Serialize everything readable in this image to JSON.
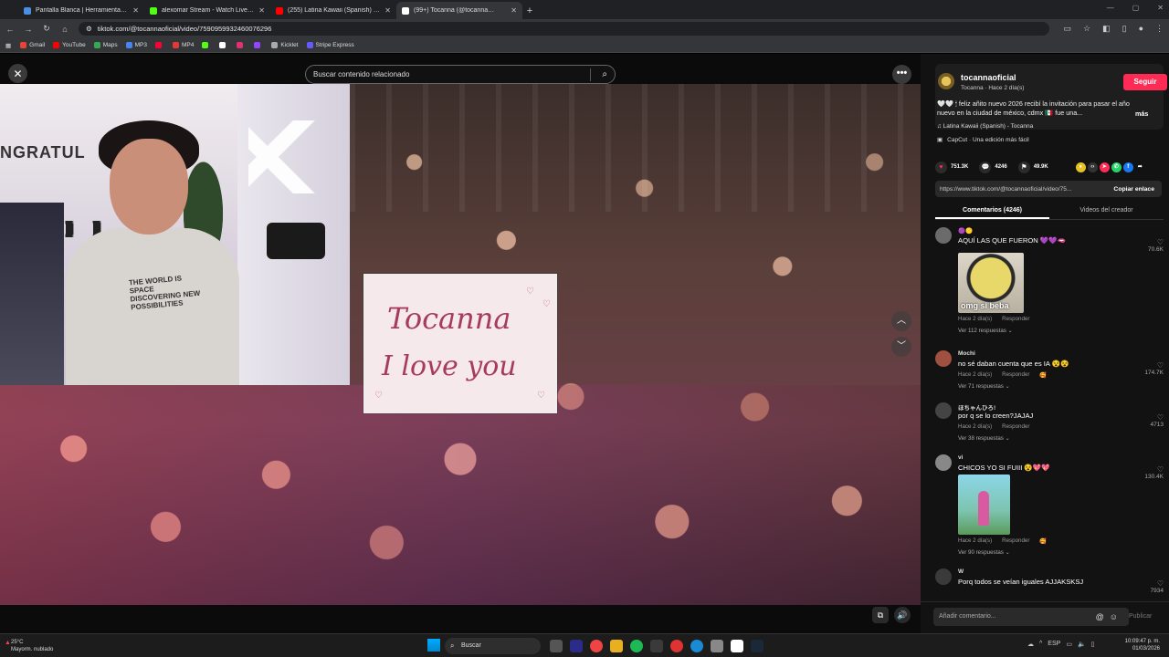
{
  "browser": {
    "tabs": [
      {
        "title": "Pantalla Blanca | Herramienta …",
        "favicon_color": "#4a90e2",
        "active": false
      },
      {
        "title": "alexomar Stream - Watch Live …",
        "favicon_color": "#53fc18",
        "active": false
      },
      {
        "title": "(255) Latina Kawaii (Spanish) - …",
        "favicon_color": "#ff0000",
        "active": false
      },
      {
        "title": "(99+) Tocanna (@tocanna…",
        "favicon_color": "#ffffff",
        "active": true
      }
    ],
    "url": "tiktok.com/@tocannaoficial/video/7590959932460076296",
    "bookmarks": [
      {
        "label": "Gmail",
        "color": "#ea4335"
      },
      {
        "label": "YouTube",
        "color": "#ff0000"
      },
      {
        "label": "Maps",
        "color": "#34a853"
      },
      {
        "label": "MP3",
        "color": "#4285f4"
      },
      {
        "label": "",
        "color": "#ff0033"
      },
      {
        "label": "MP4",
        "color": "#e53935"
      },
      {
        "label": "",
        "color": "#53fc18"
      },
      {
        "label": "",
        "color": "#ffffff"
      },
      {
        "label": "",
        "color": "#e1306c"
      },
      {
        "label": "",
        "color": "#9146ff"
      },
      {
        "label": "Kicklet",
        "color": "#aaaaaa"
      },
      {
        "label": "Stripe Express",
        "color": "#635bff"
      }
    ]
  },
  "viewer": {
    "search_placeholder": "Buscar contenido relacionado",
    "sign_line1": "Tocanna",
    "sign_line2": "I love you",
    "webcam_sign": "NGRATUL",
    "shirt_text": "THE WORLD IS SPACE DISCOVERING NEW POSSIBILITIES"
  },
  "panel": {
    "author_name": "tocannaoficial",
    "author_sub": "Tocanna · Hace 2 día(s)",
    "follow_label": "Seguir",
    "description": "🤍🤍 🕯 feliz añito nuevo 2026 recibí la invitación para pasar el año nuevo en la ciudad de méxico, cdmx 🇲🇽 fue una...",
    "more_label": "más",
    "music": "♫ Latina Kawaii (Spanish) - Tocanna",
    "capcut": "CapCut · Una edición más fácil",
    "likes": "751.3K",
    "comments_count": "4246",
    "saves": "49.9K",
    "link": "https://www.tiktok.com/@tocannaoficial/video/75...",
    "copy_label": "Copiar enlace",
    "tab_comments": "Comentarios (4246)",
    "tab_videos": "Videos del creador",
    "comments": [
      {
        "user": "🟣🟡",
        "text": "AQUÍ LAS QUE FUERON 💜💜🫦",
        "time": "Hace 2 día(s)",
        "reply": "Responder",
        "replies": "Ver 112 respuestas ⌄",
        "likes": "70.6K",
        "gif_text": "omg si beba"
      },
      {
        "user": "Mochi",
        "text": "no sé daban cuenta que es IA 😵😵",
        "time": "Hace 2 día(s)",
        "reply": "Responder",
        "replies": "Ver 71 respuestas ⌄",
        "likes": "174.7K"
      },
      {
        "user": "ほちゃんひろ!",
        "text": "por q se lo creen?JAJAJ",
        "time": "Hace 2 día(s)",
        "reply": "Responder",
        "replies": "Ver 38 respuestas ⌄",
        "likes": "4713"
      },
      {
        "user": "vi",
        "text": "CHICOS YO SI FUIII 😵💖💖",
        "time": "Hace 2 día(s)",
        "reply": "Responder",
        "replies": "Ver 90 respuestas ⌄",
        "likes": "130.4K"
      },
      {
        "user": "W",
        "text": "Porq todos se veían iguales AJJAKSKSJ",
        "likes": "7934"
      }
    ],
    "compose_placeholder": "Añadir comentario...",
    "post_label": "Publicar"
  },
  "taskbar": {
    "temp": "25°C",
    "weather": "Mayorm. nublado",
    "search": "Buscar",
    "lang": "ESP",
    "time": "10:09:47 p. m.",
    "date": "01/03/2026"
  }
}
